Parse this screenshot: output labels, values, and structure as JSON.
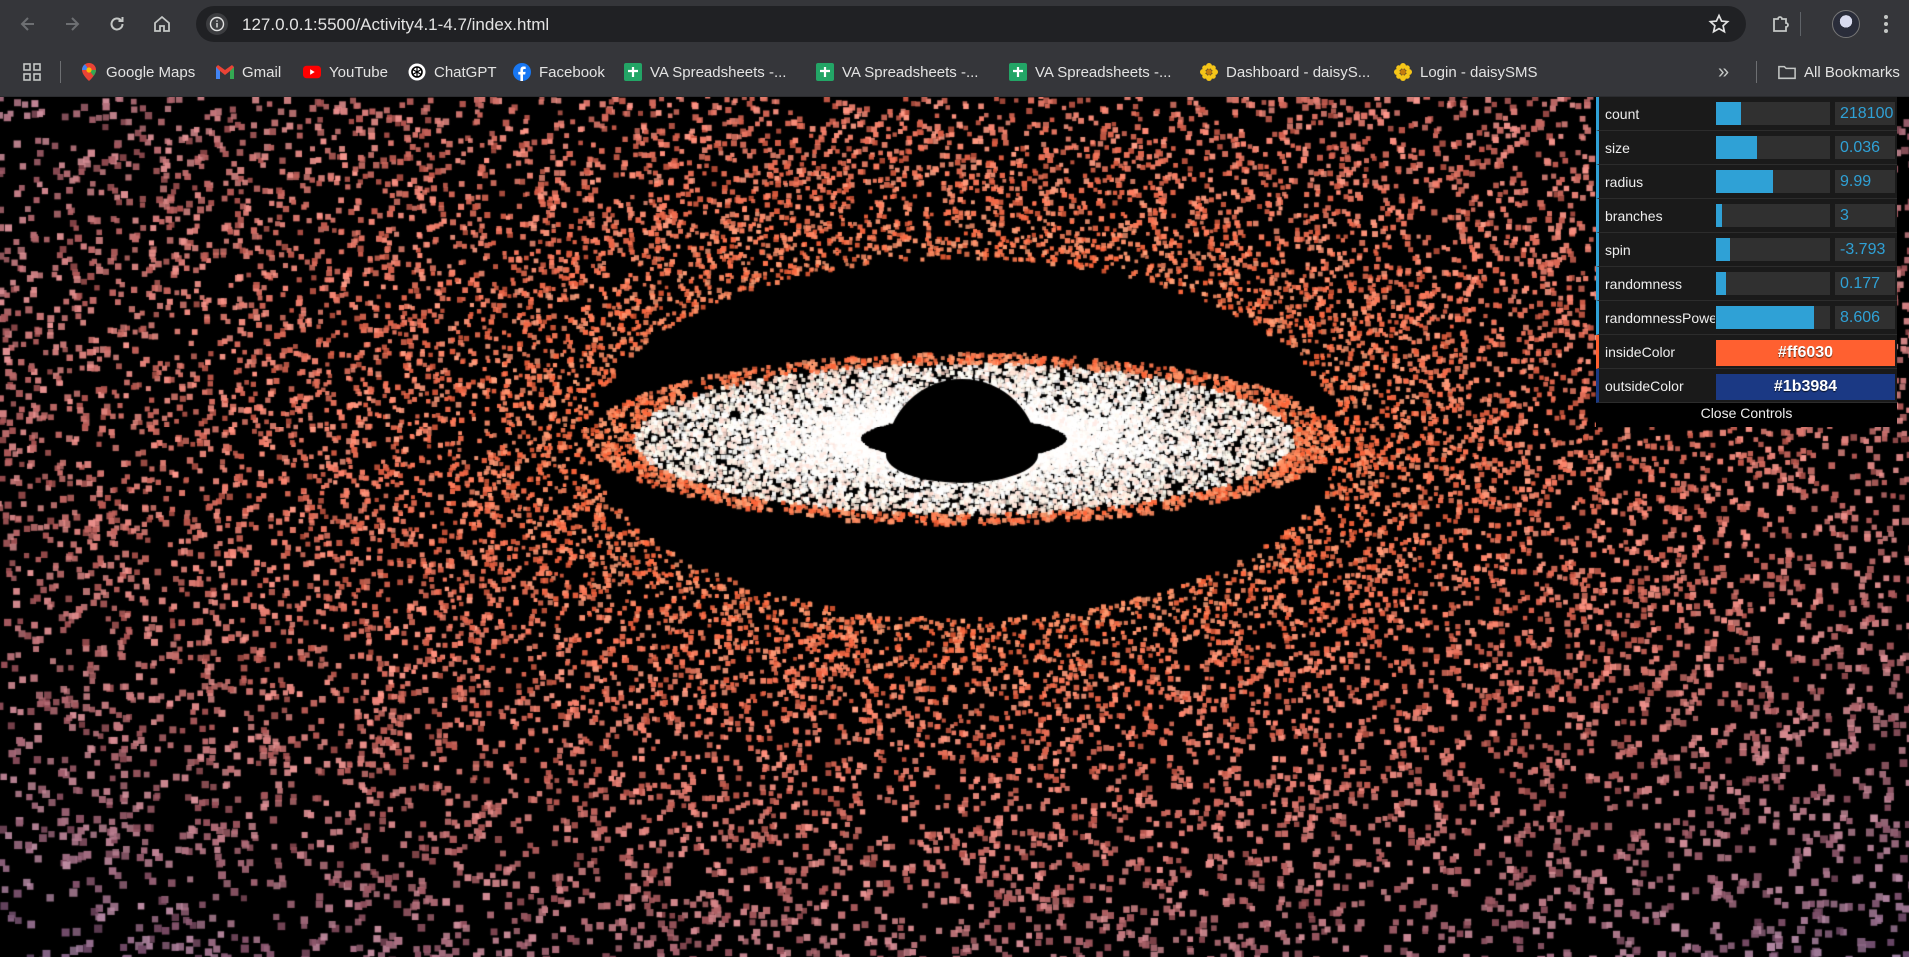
{
  "browser": {
    "url": "127.0.0.1:5500/Activity4.1-4.7/index.html",
    "icons": {
      "back": "arrow-left-icon",
      "forward": "arrow-right-icon",
      "reload": "reload-icon",
      "home": "home-icon",
      "site_info": "info-icon",
      "bookmark_star": "star-icon",
      "extensions": "puzzle-icon",
      "menu": "kebab-menu-icon"
    }
  },
  "bookmarks": {
    "items": [
      {
        "label": "Google Maps",
        "icon": "google-maps-icon"
      },
      {
        "label": "Gmail",
        "icon": "gmail-icon"
      },
      {
        "label": "YouTube",
        "icon": "youtube-icon"
      },
      {
        "label": "ChatGPT",
        "icon": "chatgpt-icon"
      },
      {
        "label": "Facebook",
        "icon": "facebook-icon"
      },
      {
        "label": "VA Spreadsheets -...",
        "icon": "sheets-icon"
      },
      {
        "label": "VA Spreadsheets -...",
        "icon": "sheets-icon"
      },
      {
        "label": "VA Spreadsheets -...",
        "icon": "sheets-icon"
      },
      {
        "label": "Dashboard - daisyS...",
        "icon": "daisy-icon"
      },
      {
        "label": "Login - daisySMS",
        "icon": "daisy-icon"
      }
    ],
    "overflow": "»",
    "all_bookmarks": "All Bookmarks"
  },
  "gui": {
    "controls": [
      {
        "label": "count",
        "value": "218100",
        "fill": 0.22
      },
      {
        "label": "size",
        "value": "0.036",
        "fill": 0.36
      },
      {
        "label": "radius",
        "value": "9.99",
        "fill": 0.5
      },
      {
        "label": "branches",
        "value": "3",
        "fill": 0.05
      },
      {
        "label": "spin",
        "value": "-3.793",
        "fill": 0.12
      },
      {
        "label": "randomness",
        "value": "0.177",
        "fill": 0.09
      },
      {
        "label": "randomnessPower",
        "value": "8.606",
        "fill": 0.86
      }
    ],
    "colors": [
      {
        "label": "insideColor",
        "value": "#ff6030"
      },
      {
        "label": "outsideColor",
        "value": "#1b3984"
      }
    ],
    "close_label": "Close Controls"
  },
  "scene": {
    "inside_color": "#ff6030",
    "outside_color": "#1b3984",
    "core_color": "#ffffff",
    "background": "#000000"
  }
}
